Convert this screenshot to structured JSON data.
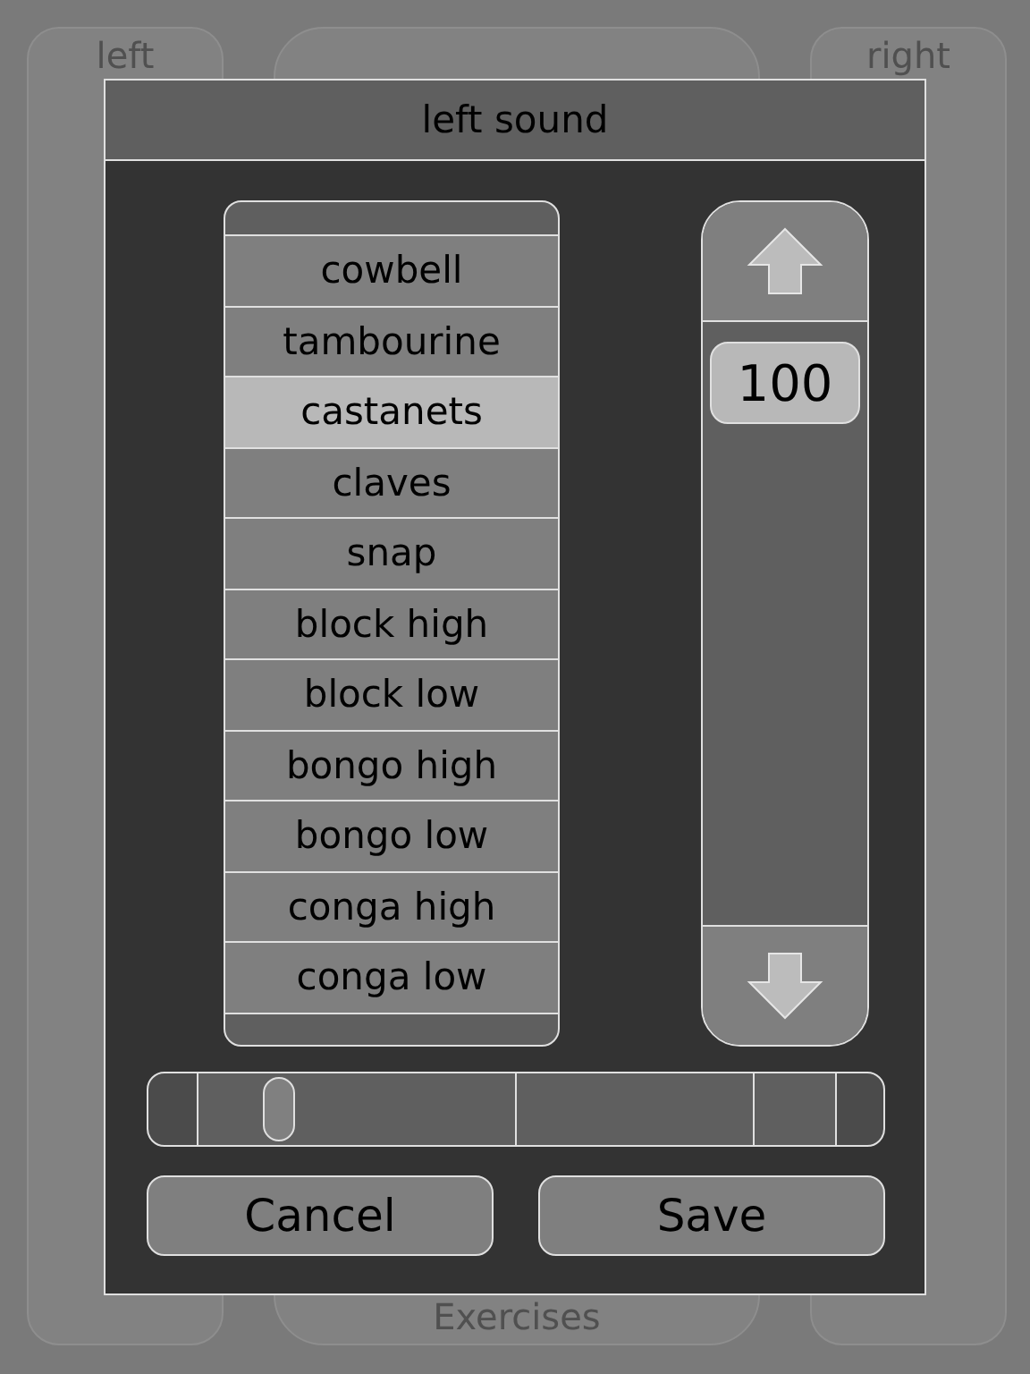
{
  "background": {
    "left_panel": {
      "title": "left"
    },
    "center_panel": {
      "title": "Exercises"
    },
    "right_panel": {
      "title": "right"
    }
  },
  "dialog": {
    "title": "left sound",
    "sounds": [
      {
        "label": "cowbell",
        "selected": false
      },
      {
        "label": "tambourine",
        "selected": false
      },
      {
        "label": "castanets",
        "selected": true
      },
      {
        "label": "claves",
        "selected": false
      },
      {
        "label": "snap",
        "selected": false
      },
      {
        "label": "block high",
        "selected": false
      },
      {
        "label": "block low",
        "selected": false
      },
      {
        "label": "bongo high",
        "selected": false
      },
      {
        "label": "bongo low",
        "selected": false
      },
      {
        "label": "conga high",
        "selected": false
      },
      {
        "label": "conga low",
        "selected": false
      }
    ],
    "volume": {
      "value": "100"
    },
    "slider": {
      "level": 0.18
    },
    "buttons": [
      {
        "label": "Cancel"
      },
      {
        "label": "Save"
      }
    ]
  }
}
